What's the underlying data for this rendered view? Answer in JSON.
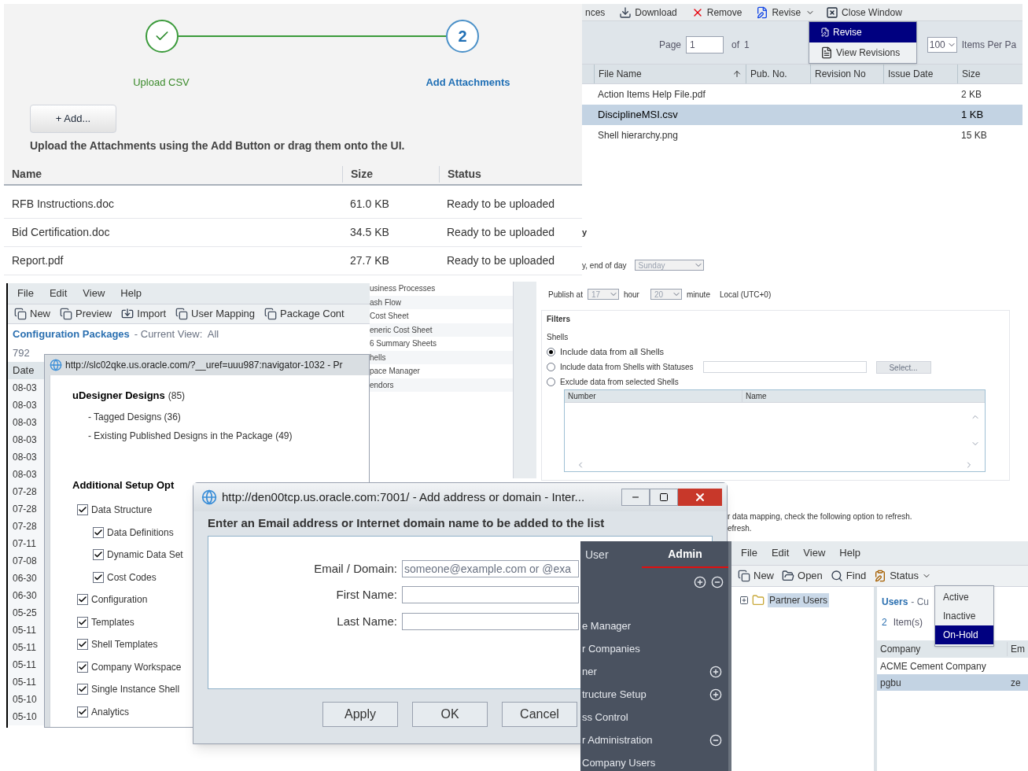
{
  "upload_wizard": {
    "steps": [
      {
        "label": "Upload CSV",
        "completed": true
      },
      {
        "label": "Add Attachments",
        "completed": false,
        "number": "2"
      }
    ],
    "add_button": "+ Add...",
    "instruction": "Upload the Attachments using the Add Button or drag them onto the UI.",
    "columns": [
      "Name",
      "Size",
      "Status"
    ],
    "rows": [
      [
        "RFB Instructions.doc",
        "61.0 KB",
        "Ready to be uploaded"
      ],
      [
        "Bid Certification.doc",
        "34.5 KB",
        "Ready to be uploaded"
      ],
      [
        "Report.pdf",
        "27.7 KB",
        "Ready to be uploaded"
      ]
    ]
  },
  "documents": {
    "toolbar": [
      {
        "label": "nces",
        "has_menu": false
      },
      {
        "label": "Download",
        "has_menu": false
      },
      {
        "label": "Remove",
        "has_menu": false
      },
      {
        "label": "Revise",
        "has_menu": true
      },
      {
        "label": "Close Window",
        "has_menu": false
      }
    ],
    "revise_menu": [
      {
        "label": "Revise",
        "selected": true
      },
      {
        "label": "View Revisions",
        "selected": false
      }
    ],
    "pager": {
      "page_label": "Page",
      "page": "1",
      "of_label": "of",
      "total": "1",
      "per_page": "100",
      "per_page_label": "Items Per Pa"
    },
    "columns": [
      {
        "label": "File Name",
        "sorted": true
      },
      {
        "label": "Pub. No.",
        "sorted": false
      },
      {
        "label": "Revision No",
        "sorted": false
      },
      {
        "label": "Issue Date",
        "sorted": false
      },
      {
        "label": "Size",
        "sorted": false
      }
    ],
    "rows": [
      {
        "file_name": "Action Items Help File.pdf",
        "size": "2 KB",
        "selected": false
      },
      {
        "file_name": "DisciplineMSI.csv",
        "size": "1 KB",
        "selected": true
      },
      {
        "file_name": "Shell hierarchy.png",
        "size": "15 KB",
        "selected": false
      }
    ]
  },
  "schedule_settings": {
    "section_title": "y",
    "day_label": "y, end of day",
    "day_value": "Sunday",
    "publish_label": "Publish at",
    "hour": "17",
    "hour_label": "hour",
    "minute": "20",
    "minute_label": "minute",
    "timezone": "Local (UTC+0)",
    "filters_title": "Filters",
    "shells_label": "Shells",
    "options": [
      {
        "label": "Include data from all Shells",
        "selected": true
      },
      {
        "label": "Include data from Shells with Statuses",
        "selected": false
      },
      {
        "label": "Exclude data from selected Shells",
        "selected": false
      }
    ],
    "select_button": "Select...",
    "shell_columns": [
      "Number",
      "Name"
    ],
    "note_lines": [
      "r data mapping, check the following option to refresh.",
      "efresh."
    ]
  },
  "business_processes": [
    "usiness Processes",
    "ash Flow",
    "Cost Sheet",
    "eneric Cost Sheet",
    "6 Summary Sheets",
    "hells",
    "pace Manager",
    "endors"
  ],
  "config_packages": {
    "menu": [
      "File",
      "Edit",
      "View",
      "Help"
    ],
    "toolbar": [
      "New",
      "Preview",
      "Import",
      "User Mapping",
      "Package Cont"
    ],
    "title": "Configuration Packages",
    "view": "- Current View:  All",
    "count": "792",
    "date_column": "Date",
    "dates": [
      "08-03",
      "08-03",
      "08-03",
      "08-03",
      "08-03",
      "08-03",
      "07-28",
      "07-28",
      "07-28",
      "07-11",
      "07-08",
      "06-30",
      "06-30",
      "05-25",
      "05-11",
      "05-11",
      "05-11",
      "05-11",
      "05-10",
      "05-10"
    ]
  },
  "package_window": {
    "url": "http://slc02qke.us.oracle.com/?__uref=uuu987:navigator-1032 - Pr",
    "designs_title": "uDesigner Designs",
    "designs_count": "(85)",
    "design_items": [
      "- Tagged Designs (36)",
      "- Existing Published Designs in the Package (49)"
    ],
    "setup_title": "Additional Setup Opt",
    "setup_options": [
      {
        "label": "Data Structure",
        "checked": true,
        "children": [
          {
            "label": "Data Definitions",
            "checked": true
          },
          {
            "label": "Dynamic Data Set",
            "checked": true
          },
          {
            "label": "Cost Codes",
            "checked": true
          }
        ]
      },
      {
        "label": "Configuration",
        "checked": true
      },
      {
        "label": "Templates",
        "checked": true
      },
      {
        "label": "Shell Templates",
        "checked": true
      },
      {
        "label": "Company Workspace",
        "checked": true
      },
      {
        "label": "Single Instance Shell",
        "checked": true
      },
      {
        "label": "Analytics",
        "checked": true
      }
    ]
  },
  "email_dialog": {
    "title": "http://den00tcp.us.oracle.com:7001/ - Add address or domain - Inter...",
    "heading": "Enter an Email address or Internet domain name to be added to the list",
    "fields": [
      {
        "label": "Email / Domain:",
        "placeholder": "someone@example.com or @exa"
      },
      {
        "label": "First Name:"
      },
      {
        "label": "Last Name:"
      }
    ],
    "buttons": [
      "Apply",
      "OK",
      "Cancel"
    ]
  },
  "admin_console": {
    "tabs": [
      {
        "label": "User",
        "selected": false
      },
      {
        "label": "Admin",
        "selected": true
      }
    ],
    "nav": [
      {
        "label": "e Manager"
      },
      {
        "label": "r Companies"
      },
      {
        "label": "ner",
        "expanded": false
      },
      {
        "label": "tructure Setup",
        "expanded": false
      },
      {
        "label": "ss Control"
      },
      {
        "label": "r Administration",
        "expanded": true
      },
      {
        "label": "Company Users"
      }
    ],
    "menu": [
      "File",
      "Edit",
      "View",
      "Help"
    ],
    "toolbar": [
      {
        "label": "New",
        "has_menu": false
      },
      {
        "label": "Open",
        "has_menu": false
      },
      {
        "label": "Find",
        "has_menu": false
      },
      {
        "label": "Status",
        "has_menu": true
      }
    ],
    "tree": {
      "label": "Partner Users",
      "expanded": false
    },
    "list_title": "Users",
    "list_view": "- Cu",
    "item_count": "2",
    "item_label": "Item(s)",
    "columns": [
      "Company",
      "Em"
    ],
    "rows": [
      {
        "company": "ACME Cement Company",
        "selected": false
      },
      {
        "company": "pgbu",
        "email": "ze",
        "selected": true
      }
    ],
    "status_menu": [
      {
        "label": "Active",
        "selected": false
      },
      {
        "label": "Inactive",
        "selected": false
      },
      {
        "label": "On-Hold",
        "selected": true
      }
    ]
  }
}
